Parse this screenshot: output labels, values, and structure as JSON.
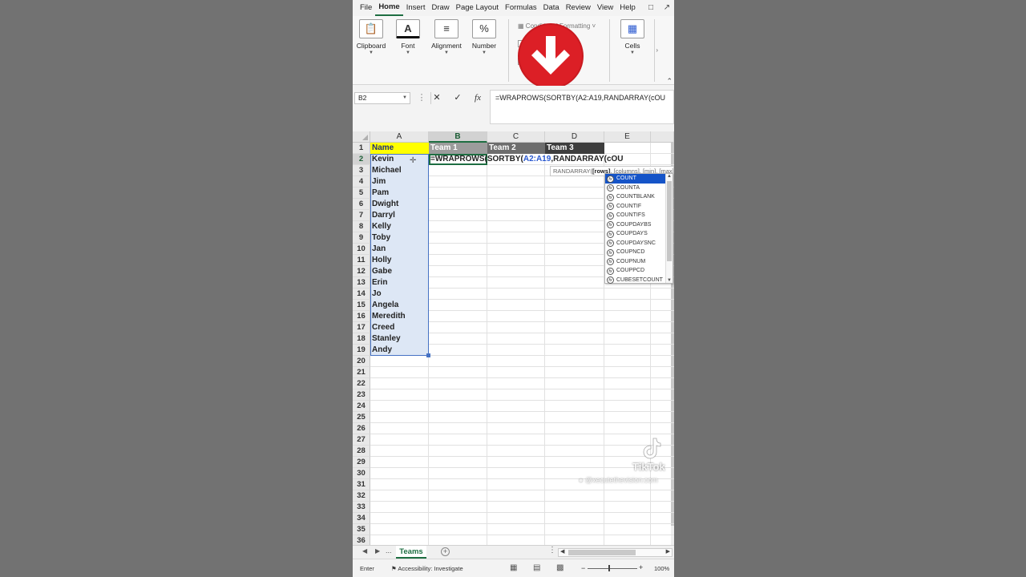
{
  "menu": {
    "items": [
      "File",
      "Home",
      "Insert",
      "Draw",
      "Page Layout",
      "Formulas",
      "Data",
      "Review",
      "View",
      "Help"
    ],
    "active_index": 1
  },
  "ribbon": {
    "clipboard": "Clipboard",
    "font": "Font",
    "alignment": "Alignment",
    "number": "Number",
    "conditional_formatting": "Conditional Formatting",
    "cells": "Cells"
  },
  "formula_bar": {
    "name_box": "B2",
    "cancel": "✕",
    "enter": "✓",
    "fx": "fx",
    "content": "=WRAPROWS(SORTBY(A2:A19,RANDARRAY(cOU"
  },
  "grid": {
    "columns": [
      "A",
      "B",
      "C",
      "D",
      "E"
    ],
    "row_numbers": [
      "1",
      "2",
      "3",
      "4",
      "5",
      "6",
      "7",
      "8",
      "9",
      "10",
      "11",
      "12",
      "13",
      "14",
      "15",
      "16",
      "17",
      "18",
      "19",
      "20",
      "21",
      "22",
      "23",
      "24",
      "25",
      "26",
      "27",
      "28",
      "29",
      "30",
      "31",
      "32",
      "33",
      "34",
      "35",
      "36"
    ],
    "headers": [
      "Name",
      "Team 1",
      "Team 2",
      "Team 3"
    ],
    "names": [
      "Kevin",
      "Michael",
      "Jim",
      "Pam",
      "Dwight",
      "Darryl",
      "Kelly",
      "Toby",
      "Jan",
      "Holly",
      "Gabe",
      "Erin",
      "Jo",
      "Angela",
      "Meredith",
      "Creed",
      "Stanley",
      "Andy"
    ],
    "active_cell": "B2",
    "edit_formula": {
      "prefix": "=WRAPROWS(SORTBY(",
      "ref": "A2:A19",
      "suffix": ",RANDARRAY(cOU"
    }
  },
  "tooltip": {
    "func": "RANDARRAY(",
    "arg1": "[rows]",
    "rest": ", [columns], [min], [max]"
  },
  "autocomplete": {
    "items": [
      "COUNT",
      "COUNTA",
      "COUNTBLANK",
      "COUNTIF",
      "COUNTIFS",
      "COUPDAYBS",
      "COUPDAYS",
      "COUPDAYSNC",
      "COUPNCD",
      "COUPNUM",
      "COUPPCD",
      "CUBESETCOUNT"
    ],
    "selected_index": 0
  },
  "watermark": {
    "brand": "TikTok",
    "user": "@xecutethevision.com"
  },
  "sheet_tabs": {
    "ellipsis": "...",
    "active": "Teams"
  },
  "status_bar": {
    "mode": "Enter",
    "accessibility": "Accessibility: Investigate",
    "zoom": "100%"
  },
  "colors": {
    "excel_green": "#1e6e42",
    "header_yellow": "#ffff00",
    "team1_fill": "#9c9c9c",
    "team2_fill": "#6d6d6d",
    "team3_fill": "#3d3d3d",
    "red_arrow_circle": "#dc1f26",
    "autocomplete_highlight": "#1554c8"
  }
}
